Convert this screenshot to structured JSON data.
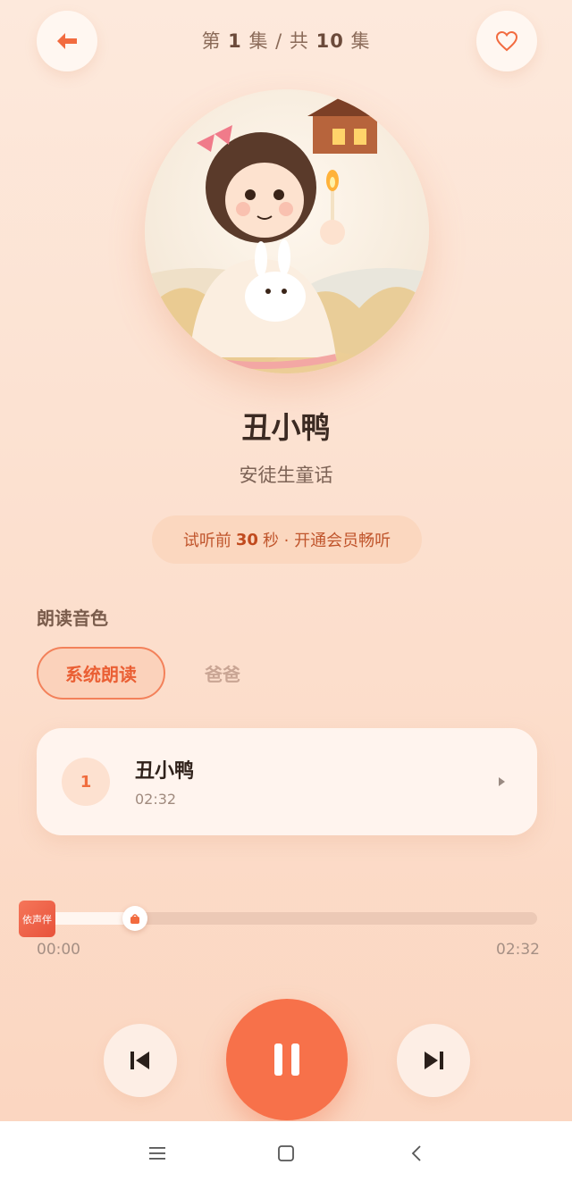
{
  "header": {
    "episode_prefix": "第",
    "episode_current": "1",
    "episode_mid": "集 / 共",
    "episode_total": "10",
    "episode_suffix": "集",
    "back_icon": "back-arrow-icon",
    "favorite_icon": "heart-icon"
  },
  "story": {
    "title": "丑小鸭",
    "author": "安徒生童话",
    "cover_icon": "cover-illustration"
  },
  "trial": {
    "prefix": "试听前",
    "seconds": "30",
    "suffix": "秒 · 开通会员畅听"
  },
  "voice": {
    "label": "朗读音色",
    "options": [
      {
        "label": "系统朗读",
        "selected": true
      },
      {
        "label": "爸爸",
        "selected": false
      }
    ]
  },
  "tracks": [
    {
      "number": "1",
      "name": "丑小鸭",
      "duration": "02:32",
      "icon": "play-triangle-icon"
    }
  ],
  "player": {
    "current_time": "00:00",
    "total_time": "02:32",
    "progress": 0.197,
    "logo_text": "依声伴",
    "prev_icon": "skip-previous-icon",
    "pause_icon": "pause-icon",
    "next_icon": "skip-next-icon"
  },
  "system_nav": {
    "menu_icon": "menu-icon",
    "home_icon": "home-square-icon",
    "back_icon": "back-chevron-icon"
  },
  "colors": {
    "accent": "#f7714a",
    "background": "#fde9dc",
    "selected_chip": "#ea5f34"
  }
}
